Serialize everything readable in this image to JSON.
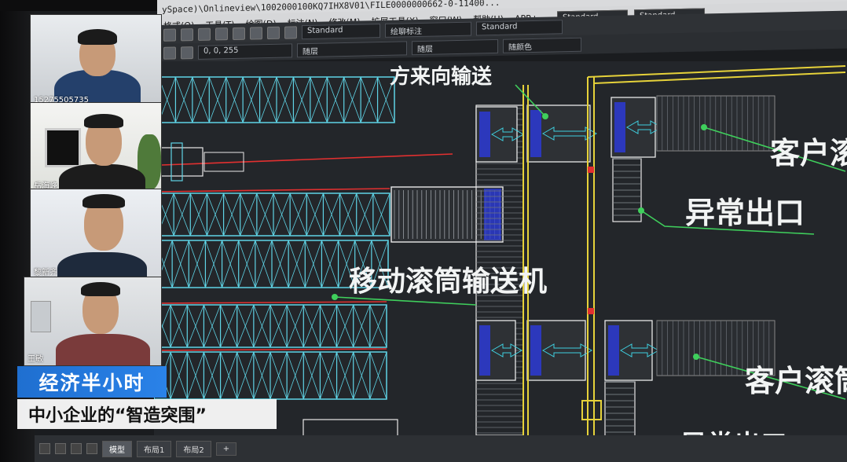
{
  "app": {
    "title_text": "ySpace)\\Onlineview\\1002000100KQ7IHX8V01\\FILE0000000662-0-11400...",
    "menu": [
      "格式(O)",
      "工具(T)",
      "绘图(D)",
      "标注(N)",
      "修改(M)",
      "扩展工具(X)",
      "窗口(W)",
      "帮助(H)",
      "APP+"
    ],
    "style_combos": [
      "Standard",
      "Standard"
    ],
    "toolbar": {
      "text_style": "Standard",
      "dim_style": "绘聊标注",
      "table_style": "Standard",
      "color_value": "0, 0, 255",
      "linetype": "随层",
      "lineweight": "随层",
      "plot_style": "随颜色"
    },
    "status_tabs": [
      "模型",
      "布局1",
      "布局2",
      "+"
    ]
  },
  "participants": [
    {
      "name": "15275505735"
    },
    {
      "name": "岳海峰"
    },
    {
      "name": "黎新齐"
    },
    {
      "name": "王敏"
    }
  ],
  "drawing": {
    "labels": {
      "top_fragment": "方来向输送",
      "customer_1": "客户滚",
      "abnormal_1": "异常出口",
      "mobile_conveyor": "移动滚筒输送机",
      "customer_2": "客户滚筒",
      "abnormal_2": "异常出口"
    },
    "colors": {
      "rack": "#5fd4e6",
      "red_line": "#e23030",
      "yellow_line": "#e6d23a",
      "green_leader": "#3fcf5c",
      "blue_fill": "#2b3ad4",
      "white_line": "#e8e8e8"
    }
  },
  "captions": {
    "program": "经济半小时",
    "subtitle": "中小企业的“智造突围”"
  }
}
